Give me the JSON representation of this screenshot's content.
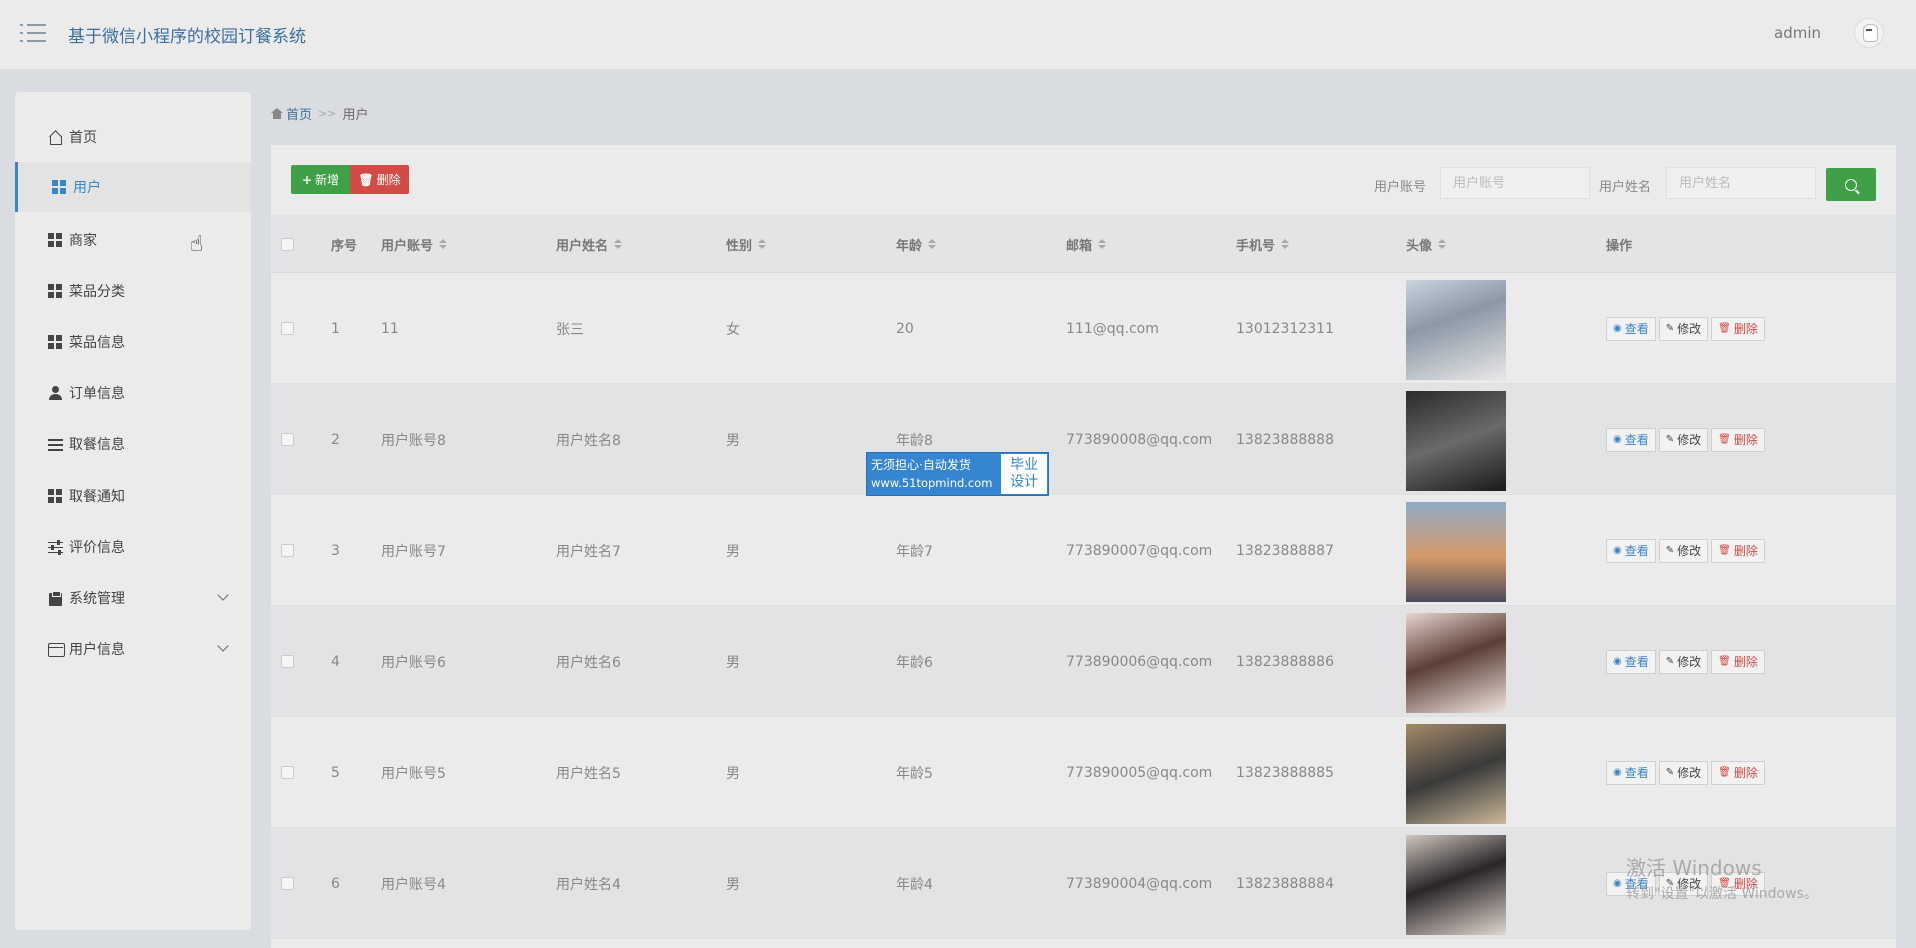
{
  "header": {
    "title": "基于微信小程序的校园订餐系统",
    "user": "admin"
  },
  "sidebar": {
    "items": [
      {
        "label": "首页",
        "icon": "home-icon"
      },
      {
        "label": "用户",
        "icon": "grid-icon",
        "active": true
      },
      {
        "label": "商家",
        "icon": "grid-icon"
      },
      {
        "label": "菜品分类",
        "icon": "grid-icon"
      },
      {
        "label": "菜品信息",
        "icon": "grid-icon"
      },
      {
        "label": "订单信息",
        "icon": "person-icon"
      },
      {
        "label": "取餐信息",
        "icon": "list-icon"
      },
      {
        "label": "取餐通知",
        "icon": "grid-icon"
      },
      {
        "label": "评价信息",
        "icon": "sliders-icon"
      },
      {
        "label": "系统管理",
        "icon": "clipboard-icon",
        "expandable": true
      },
      {
        "label": "用户信息",
        "icon": "card-icon",
        "expandable": true
      }
    ]
  },
  "breadcrumb": {
    "home": "首页",
    "separator": ">>",
    "current": "用户"
  },
  "toolbar": {
    "add_label": "新增",
    "delete_label": "删除",
    "account_label": "用户账号",
    "account_placeholder": "用户账号",
    "name_label": "用户姓名",
    "name_placeholder": "用户姓名"
  },
  "table": {
    "columns": [
      "序号",
      "用户账号",
      "用户姓名",
      "性别",
      "年龄",
      "邮箱",
      "手机号",
      "头像",
      "操作"
    ],
    "actions": {
      "view": "查看",
      "edit": "修改",
      "delete": "删除"
    },
    "rows": [
      {
        "no": "1",
        "account": "11",
        "name": "张三",
        "gender": "女",
        "age": "20",
        "email": "111@qq.com",
        "phone": "13012312311"
      },
      {
        "no": "2",
        "account": "用户账号8",
        "name": "用户姓名8",
        "gender": "男",
        "age": "年龄8",
        "email": "773890008@qq.com",
        "phone": "13823888888"
      },
      {
        "no": "3",
        "account": "用户账号7",
        "name": "用户姓名7",
        "gender": "男",
        "age": "年龄7",
        "email": "773890007@qq.com",
        "phone": "13823888887"
      },
      {
        "no": "4",
        "account": "用户账号6",
        "name": "用户姓名6",
        "gender": "男",
        "age": "年龄6",
        "email": "773890006@qq.com",
        "phone": "13823888886"
      },
      {
        "no": "5",
        "account": "用户账号5",
        "name": "用户姓名5",
        "gender": "男",
        "age": "年龄5",
        "email": "773890005@qq.com",
        "phone": "13823888885"
      },
      {
        "no": "6",
        "account": "用户账号4",
        "name": "用户姓名4",
        "gender": "男",
        "age": "年龄4",
        "email": "773890004@qq.com",
        "phone": "13823888884"
      }
    ]
  },
  "watermark": {
    "line1": "无须担心·自动发货",
    "line2": "www.51topmind.com",
    "badge1": "毕业",
    "badge2": "设计"
  },
  "windows_activation": {
    "line1": "激活 Windows",
    "line2": "转到\"设置\"以激活 Windows。"
  },
  "colors": {
    "accent": "#3a84c8",
    "success": "#3fa047",
    "danger": "#d24b47",
    "title": "#3a6f9f"
  }
}
